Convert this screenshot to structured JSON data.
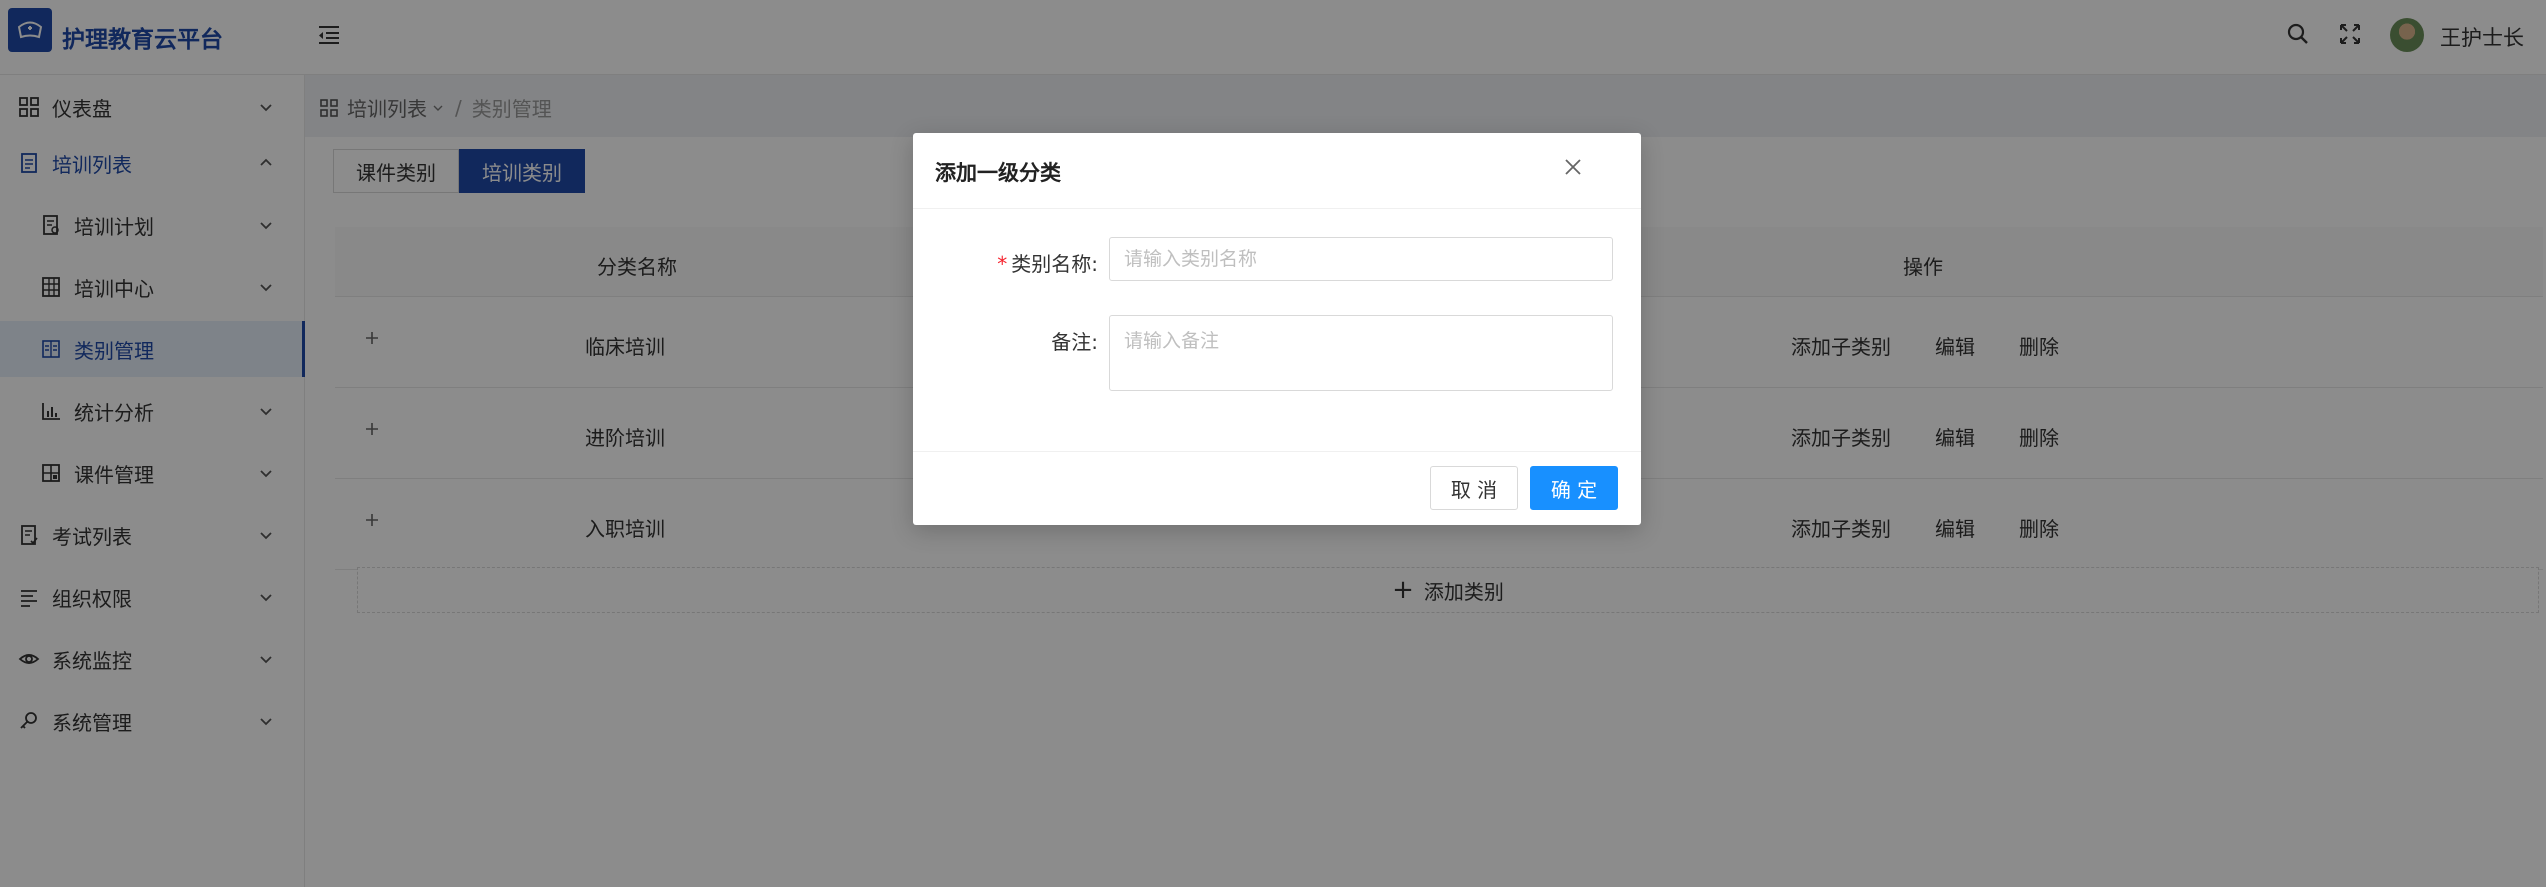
{
  "app": {
    "title": "护理教育云平台"
  },
  "header": {
    "username": "王护士长"
  },
  "sidebar": {
    "items": [
      {
        "label": "仪表盘"
      },
      {
        "label": "培训列表"
      },
      {
        "label": "培训计划"
      },
      {
        "label": "培训中心"
      },
      {
        "label": "类别管理"
      },
      {
        "label": "统计分析"
      },
      {
        "label": "课件管理"
      },
      {
        "label": "考试列表"
      },
      {
        "label": "组织权限"
      },
      {
        "label": "系统监控"
      },
      {
        "label": "系统管理"
      }
    ]
  },
  "breadcrumb": {
    "parent": "培训列表",
    "separator": "/",
    "current": "类别管理"
  },
  "tabs": [
    {
      "label": "课件类别"
    },
    {
      "label": "培训类别"
    }
  ],
  "table": {
    "columns": [
      "分类名称",
      "操作"
    ],
    "rows": [
      {
        "name": "临床培训"
      },
      {
        "name": "进阶培训"
      },
      {
        "name": "入职培训"
      }
    ],
    "actions": {
      "add_child": "添加子类别",
      "edit": "编辑",
      "delete": "删除"
    },
    "add_label": "添加类别"
  },
  "modal": {
    "title": "添加一级分类",
    "required_mark": "*",
    "name_label": "类别名称:",
    "name_placeholder": "请输入类别名称",
    "remark_label": "备注:",
    "remark_placeholder": "请输入备注",
    "cancel": "取 消",
    "ok": "确 定"
  },
  "colors": {
    "brand": "#1f4aa8",
    "primary_button": "#1890ff",
    "required": "#f5222d"
  }
}
